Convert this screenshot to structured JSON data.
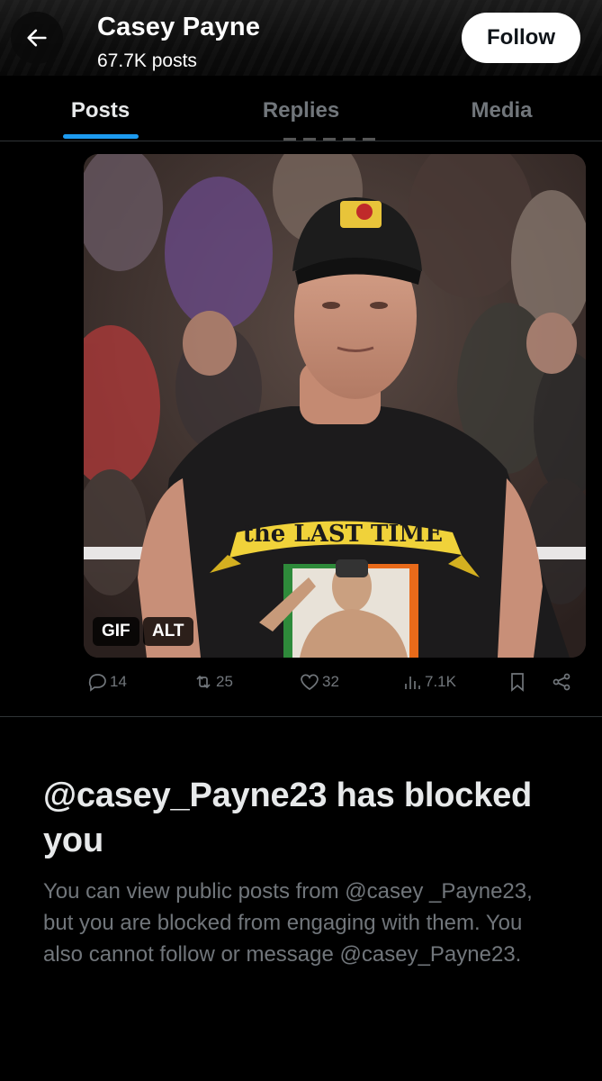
{
  "header": {
    "name": "Casey Payne",
    "post_count": "67.7K posts",
    "follow_label": "Follow",
    "back_icon": "arrow-left-icon"
  },
  "tabs": [
    {
      "label": "Posts",
      "active": true
    },
    {
      "label": "Replies",
      "active": false
    },
    {
      "label": "Media",
      "active": false
    }
  ],
  "media": {
    "badges": [
      "GIF",
      "ALT"
    ],
    "shirt_text": "the LAST TIME"
  },
  "post_actions": {
    "replies": "14",
    "reposts": "25",
    "likes": "32",
    "views": "7.1K"
  },
  "blocked": {
    "title": "@casey_Payne23 has blocked you",
    "description": "You can view public posts from @casey _Payne23, but you are blocked from engaging with them. You also cannot follow or message @casey_Payne23."
  },
  "colors": {
    "accent": "#1d9bf0",
    "background": "#000000",
    "muted_text": "#71767b"
  }
}
